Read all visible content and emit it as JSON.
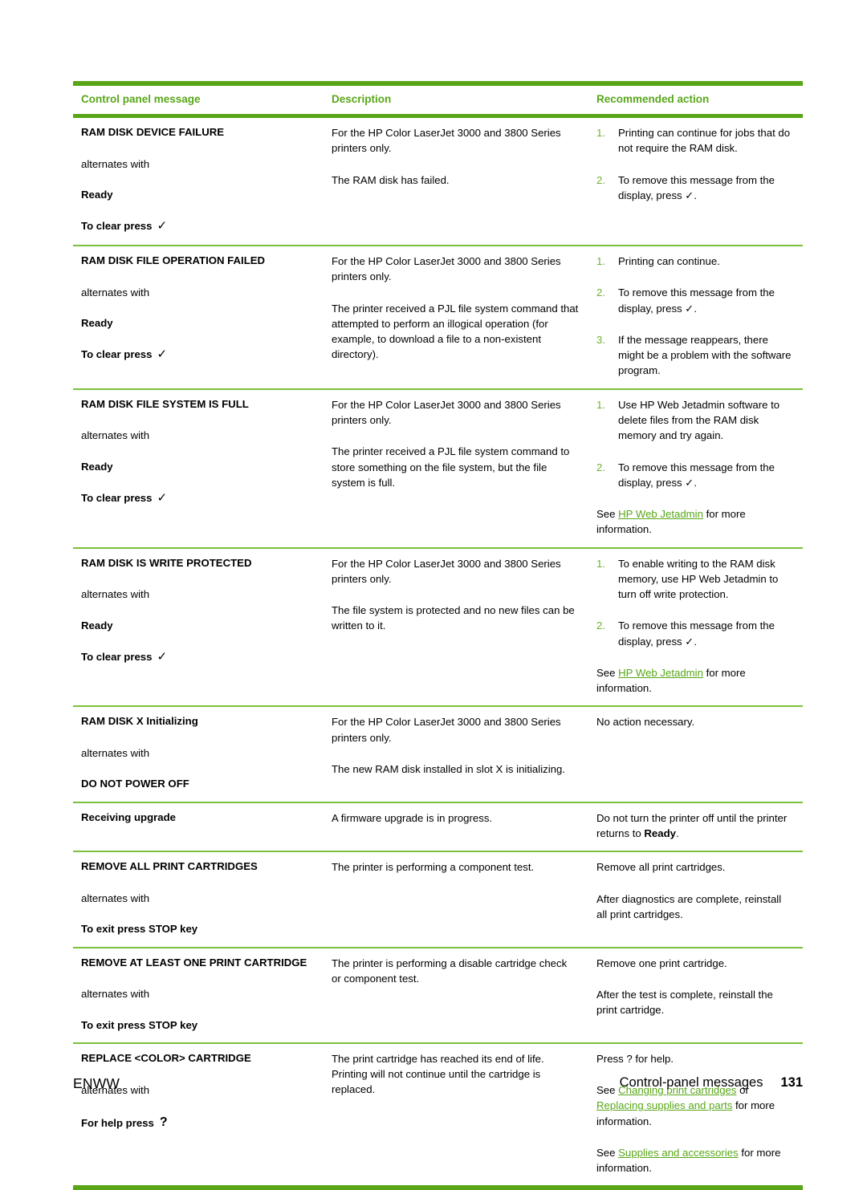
{
  "table": {
    "headers": {
      "col1": "Control panel message",
      "col2": "Description",
      "col3": "Recommended action"
    },
    "accent_color": "#58a618",
    "rows": [
      {
        "message": "RAM DISK DEVICE FAILURE",
        "alternates_label": "alternates with",
        "state": "Ready",
        "clear_label": "To clear press",
        "clear_glyph": "✓",
        "description": [
          "For the HP Color LaserJet 3000 and 3800 Series printers only.",
          "The RAM disk has failed."
        ],
        "steps": [
          "Printing can continue for jobs that do not require the RAM disk.",
          "To remove this message from the display, press ✓."
        ],
        "notes": []
      },
      {
        "message": "RAM DISK FILE OPERATION FAILED",
        "alternates_label": "alternates with",
        "state": "Ready",
        "clear_label": "To clear press",
        "clear_glyph": "✓",
        "description": [
          "For the HP Color LaserJet 3000 and 3800 Series printers only.",
          "The printer received a PJL file system command that attempted to perform an illogical operation (for example, to download a file to a non-existent directory)."
        ],
        "steps": [
          "Printing can continue.",
          "To remove this message from the display, press ✓.",
          "If the message reappears, there might be a problem with the software program."
        ],
        "notes": []
      },
      {
        "message": "RAM DISK FILE SYSTEM IS FULL",
        "alternates_label": "alternates with",
        "state": "Ready",
        "clear_label": "To clear press",
        "clear_glyph": "✓",
        "description": [
          "For the HP Color LaserJet 3000 and 3800 Series printers only.",
          "The printer received a PJL file system command to store something on the file system, but the file system is full."
        ],
        "steps": [
          "Use HP Web Jetadmin software to delete files from the RAM disk memory and try again.",
          "To remove this message from the display, press ✓."
        ],
        "notes": [
          {
            "prefix": "See ",
            "link": "HP Web Jetadmin",
            "suffix": " for more information."
          }
        ]
      },
      {
        "message": "RAM DISK IS WRITE PROTECTED",
        "alternates_label": "alternates with",
        "state": "Ready",
        "clear_label": "To clear press",
        "clear_glyph": "✓",
        "description": [
          "For the HP Color LaserJet 3000 and 3800 Series printers only.",
          "The file system is protected and no new files can be written to it."
        ],
        "steps": [
          "To enable writing to the RAM disk memory, use HP Web Jetadmin to turn off write protection.",
          "To remove this message from the display, press ✓."
        ],
        "notes": [
          {
            "prefix": "See ",
            "link": "HP Web Jetadmin",
            "suffix": " for more information."
          }
        ]
      },
      {
        "message": "RAM DISK X Initializing",
        "alternates_label": "alternates with",
        "state": "DO NOT POWER OFF",
        "clear_label": "",
        "clear_glyph": "",
        "description": [
          "For the HP Color LaserJet 3000 and 3800 Series printers only.",
          "The new RAM disk installed in slot X is initializing."
        ],
        "steps": [],
        "plain_actions": [
          "No action necessary."
        ],
        "notes": []
      },
      {
        "message": "Receiving upgrade",
        "alternates_label": "",
        "state": "",
        "clear_label": "",
        "clear_glyph": "",
        "description": [
          "A firmware upgrade is in progress."
        ],
        "steps": [],
        "plain_actions": [
          "Do not turn the printer off until the printer returns to Ready."
        ],
        "bold_words": [
          "Ready"
        ],
        "notes": []
      },
      {
        "message": "REMOVE ALL PRINT CARTRIDGES",
        "alternates_label": "alternates with",
        "state": "To exit press STOP key",
        "clear_label": "",
        "clear_glyph": "",
        "description": [
          "The printer is performing a component test."
        ],
        "steps": [],
        "plain_actions": [
          "Remove all print cartridges.",
          "After diagnostics are complete, reinstall all print cartridges."
        ],
        "notes": []
      },
      {
        "message": "REMOVE AT LEAST ONE PRINT CARTRIDGE",
        "alternates_label": "alternates with",
        "state": "To exit press STOP key",
        "clear_label": "",
        "clear_glyph": "",
        "description": [
          "The printer is performing a disable cartridge check or component test."
        ],
        "steps": [],
        "plain_actions": [
          "Remove one print cartridge.",
          "After the test is complete, reinstall the print cartridge."
        ],
        "notes": []
      },
      {
        "message": "REPLACE <COLOR> CARTRIDGE",
        "alternates_label": "alternates with",
        "state": "For help press",
        "clear_label": "",
        "clear_glyph": "?",
        "description": [
          "The print cartridge has reached its end of life. Printing will not continue until the cartridge is replaced."
        ],
        "steps": [],
        "plain_actions": [
          "Press ? for help."
        ],
        "notes": [
          {
            "prefix": "See ",
            "link": "Changing print cartridges",
            "middle": " or ",
            "link2": "Replacing supplies and parts",
            "suffix": " for more information."
          },
          {
            "prefix": "See ",
            "link": "Supplies and accessories",
            "suffix": " for more information."
          }
        ]
      }
    ]
  },
  "footer": {
    "left": "ENWW",
    "section": "Control-panel messages",
    "page": "131"
  }
}
